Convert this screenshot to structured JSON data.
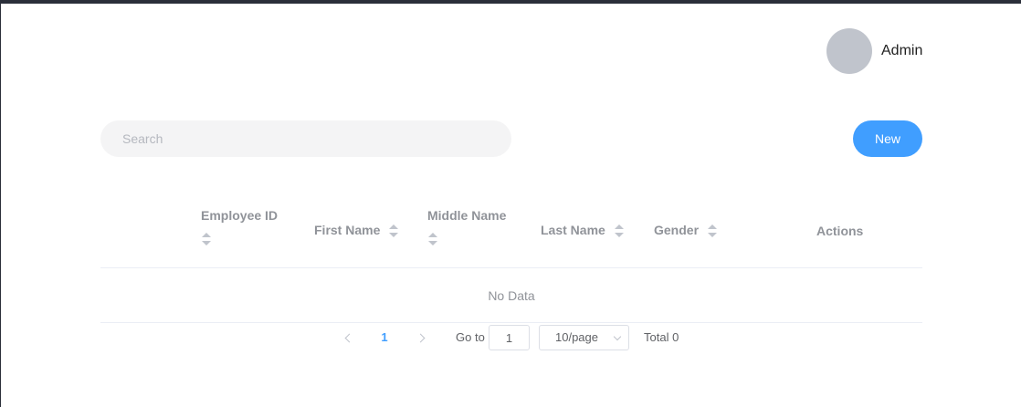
{
  "header": {
    "user_name": "Admin"
  },
  "search": {
    "placeholder": "Search",
    "value": ""
  },
  "toolbar": {
    "new_label": "New"
  },
  "table": {
    "columns": [
      {
        "label": "Employee ID",
        "sortable": true
      },
      {
        "label": "First Name",
        "sortable": true
      },
      {
        "label": "Middle Name",
        "sortable": true
      },
      {
        "label": "Last Name",
        "sortable": true
      },
      {
        "label": "Gender",
        "sortable": true
      },
      {
        "label": "Actions",
        "sortable": false
      }
    ],
    "empty_text": "No Data"
  },
  "pagination": {
    "current_page": "1",
    "goto_label": "Go to",
    "goto_value": "1",
    "page_size": "10/page",
    "total": "Total 0"
  },
  "colors": {
    "accent": "#409eff",
    "avatar": "#c0c4cc",
    "header_text": "#909399"
  },
  "icons": {
    "sort": "sort-caret-icon",
    "prev": "chevron-left-icon",
    "next": "chevron-right-icon",
    "dropdown": "chevron-down-icon"
  }
}
